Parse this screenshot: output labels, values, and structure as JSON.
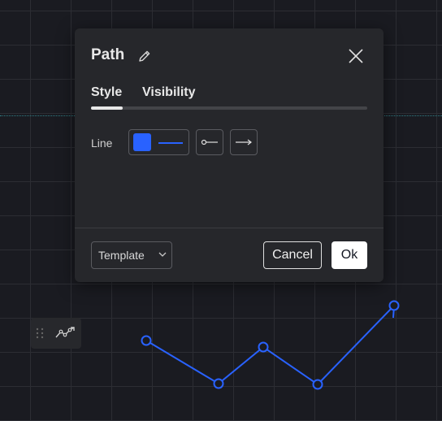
{
  "dialog": {
    "title": "Path",
    "tabs": [
      {
        "label": "Style",
        "active": true
      },
      {
        "label": "Visibility",
        "active": false
      }
    ],
    "line_label": "Line",
    "line_color": "#2962ff",
    "line_start_style": "circle-start-icon",
    "line_end_style": "arrow-end-icon",
    "template_label": "Template",
    "cancel_label": "Cancel",
    "ok_label": "Ok"
  },
  "colors": {
    "background": "#1a1b21",
    "dialog": "#26272b",
    "accent": "#2962ff"
  },
  "floating_toolbar": {
    "tool_icon": "path-tool-icon"
  }
}
